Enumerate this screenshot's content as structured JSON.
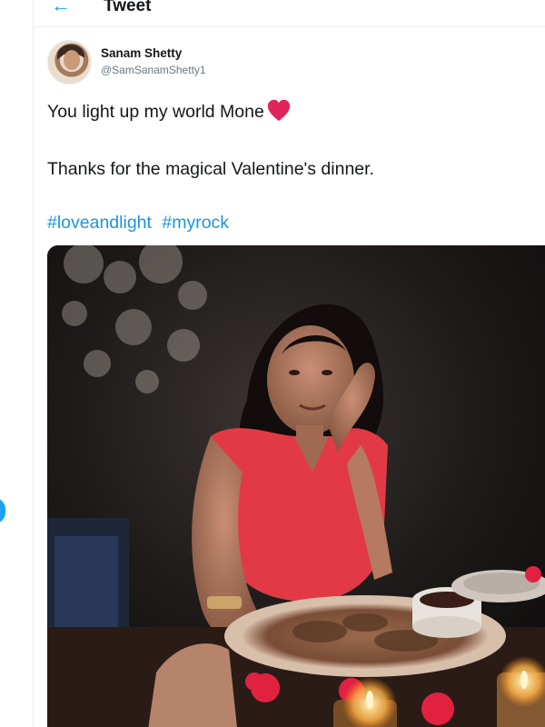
{
  "header": {
    "title": "Tweet",
    "back_icon": "arrow-left-icon"
  },
  "author": {
    "display_name": "Sanam Shetty",
    "handle": "@SamSanamShetty1"
  },
  "tweet": {
    "line1": "You light up my world Mone",
    "line2": "Thanks for the magical Valentine's dinner.",
    "hashtags": [
      "#loveandlight",
      "#myrock"
    ]
  },
  "colors": {
    "accent": "#1da1f2",
    "hashtag": "#1b95e0",
    "text": "#14171a",
    "muted": "#657786",
    "heart": "#e0245e"
  },
  "icons": {
    "heart": "red-heart-icon"
  }
}
